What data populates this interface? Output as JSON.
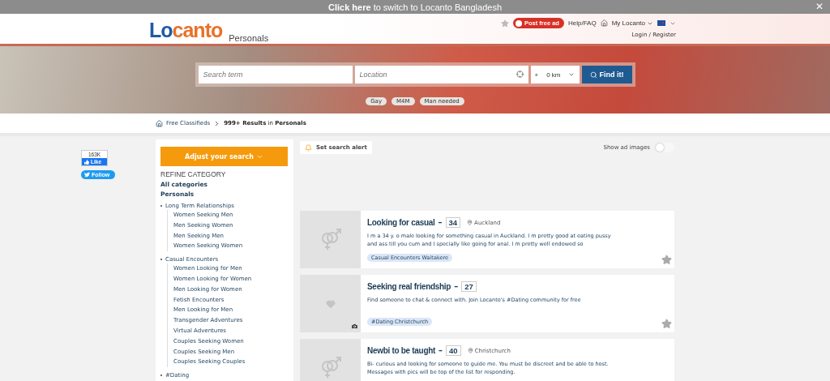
{
  "banner": {
    "link": "Click here",
    "text": "to switch to Locanto Bangladesh",
    "close": "✕"
  },
  "header": {
    "logo": [
      "Lo",
      "canto"
    ],
    "section": "Personals",
    "post_button": "Post free ad",
    "help": "Help/FAQ",
    "my_locanto": "My Locanto",
    "login": "Login / Register"
  },
  "search": {
    "term_placeholder": "Search term",
    "location_placeholder": "Location",
    "radius_plus": "+",
    "radius": "0 km",
    "button": "Find it!",
    "chips": [
      "Gay",
      "M4M",
      "Man needed"
    ]
  },
  "breadcrumb": {
    "home": "Free Classifieds",
    "results": "**999+ Results** in **Personals**"
  },
  "social": {
    "like_count": "163K",
    "like": "Like",
    "follow": "Follow"
  },
  "sidebar": {
    "adjust": "Adjust your search",
    "heading": "REFINE CATEGORY",
    "all": "All categories",
    "current": "Personals",
    "groups": [
      {
        "label": "Long Term Relationships",
        "children": [
          {
            "label": "Women Seeking Men"
          },
          {
            "label": "Men Seeking Women"
          },
          {
            "label": "Men Seeking Men"
          },
          {
            "label": "Women Seeking Women"
          }
        ]
      },
      {
        "label": "Casual Encounters",
        "children": [
          {
            "label": "Women Looking for Men"
          },
          {
            "label": "Women Looking for Women"
          },
          {
            "label": "Men Looking for Women"
          },
          {
            "label": "Fetish Encounters"
          },
          {
            "label": "Men Looking for Men"
          },
          {
            "label": "Transgender Adventures"
          },
          {
            "label": "Virtual Adventures"
          },
          {
            "label": "Couples Seeking Women"
          },
          {
            "label": "Couples Seeking Men"
          },
          {
            "label": "Couples Seeking Couples"
          }
        ]
      },
      {
        "label": "#Dating"
      }
    ]
  },
  "results": {
    "alert": "Set search alert",
    "show_images": {
      "label": "Show ad images",
      "on": false
    },
    "listings": [
      {
        "kind": "gender",
        "title": "Looking for casual",
        "dash": "–",
        "age": "34",
        "location": "Auckland",
        "text": "I m a 34 y. o male looking for something casual in Auckland. I m pretty good at eating pussy and ass till you cum and I specially like going for anal. I m pretty well endowed so",
        "tag": "Casual Encounters Waitakere",
        "camera": false
      },
      {
        "kind": "heart",
        "title": "Seeking real friendship",
        "dash": "–",
        "age": "27",
        "text": "Find someone to chat & connect with. Join Locanto's #Dating community for free",
        "tag": "#Dating Christchurch",
        "camera": true
      },
      {
        "kind": "gender",
        "title": "Newbi to be taught",
        "dash": "–",
        "age": "40",
        "location": "Christchurch",
        "text": "Bi- curious and looking for someone to guide me. You must be discreet and be able to host. Messages with pics will be top of the list for responding.",
        "camera": false
      }
    ]
  }
}
